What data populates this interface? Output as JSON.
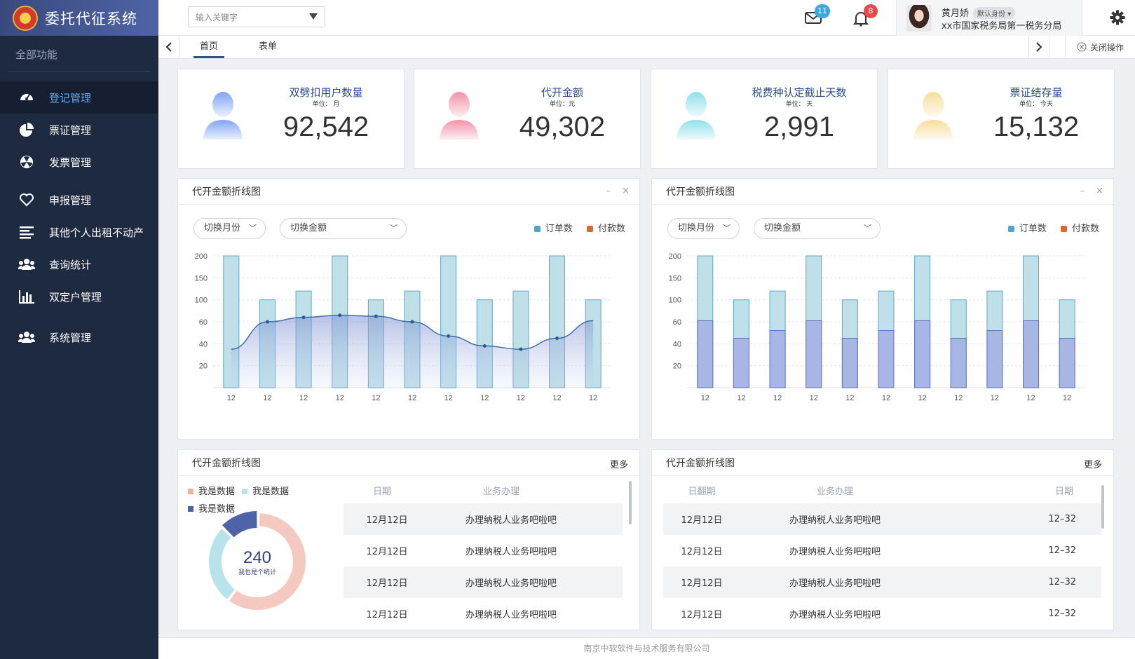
{
  "app": {
    "title": "委托代征系统",
    "all_functions": "全部功能"
  },
  "sidebar": {
    "items": [
      {
        "label": "登记管理",
        "icon": "dashboard-icon",
        "active": true
      },
      {
        "label": "票证管理",
        "icon": "pie-chart-icon"
      },
      {
        "label": "发票管理",
        "icon": "radiation-icon"
      },
      {
        "label": "申报管理",
        "icon": "heart-icon"
      },
      {
        "label": "其他个人出租不动产",
        "icon": "list-icon"
      },
      {
        "label": "查询统计",
        "icon": "users-icon"
      },
      {
        "label": "双定户管理",
        "icon": "bar-chart-icon"
      },
      {
        "label": "系统管理",
        "icon": "group-icon"
      }
    ]
  },
  "header": {
    "search_placeholder": "输入关键字",
    "mail_badge": "11",
    "bell_badge": "8",
    "user_name": "黄月娇",
    "user_role": "默认身份 ▾",
    "user_org": "xx市国家税务局第一税务分局"
  },
  "tabs": {
    "items": [
      "首页",
      "表单"
    ],
    "close_label": "关闭操作"
  },
  "stats": [
    {
      "title": "双劈扣用户数量",
      "unit": "单位：  月",
      "value": "92,542",
      "color": "#7fa6f2"
    },
    {
      "title": "代开金额",
      "unit": "单位：元",
      "value": "49,302",
      "color": "#f391a8"
    },
    {
      "title": "税费种认定截止天数",
      "unit": "单位：  天",
      "value": "2,991",
      "color": "#8fe0ea"
    },
    {
      "title": "票证结存量",
      "unit": "单位：  今天",
      "value": "15,132",
      "color": "#f7dd9a"
    }
  ],
  "panels": {
    "chart1": {
      "title": "代开金额折线图",
      "select1": "切换月份",
      "select2": "切换金额",
      "min_icon": "–",
      "close_icon": "×"
    },
    "chart2": {
      "title": "代开金额折线图",
      "select1": "切换月份",
      "select2": "切换金额",
      "min_icon": "–",
      "close_icon": "×"
    },
    "table1": {
      "title": "代开金额折线图",
      "more": "更多",
      "col1": "日期",
      "col2": "业务办理"
    },
    "table2": {
      "title": "代开金额折线图",
      "more": "更多",
      "col1": "日翻期",
      "col2": "业务办理",
      "col3": "日期"
    }
  },
  "chart_data": [
    {
      "type": "bar",
      "title": "代开金额折线图",
      "y_ticks": [
        "20",
        "40",
        "60",
        "100",
        "150",
        "200"
      ],
      "categories": [
        "12",
        "12",
        "12",
        "12",
        "12",
        "12",
        "12",
        "12",
        "12",
        "12",
        "12"
      ],
      "series": [
        {
          "name": "订单数",
          "color": "#4ba7c6",
          "values": [
            200,
            100,
            120,
            200,
            100,
            120,
            200,
            100,
            120,
            200,
            100
          ]
        },
        {
          "name": "付款数",
          "color": "#e8632b",
          "values": [
            35,
            60,
            68,
            72,
            70,
            60,
            47,
            38,
            35,
            45,
            62
          ]
        }
      ]
    },
    {
      "type": "bar",
      "title": "代开金额折线图",
      "y_ticks": [
        "20",
        "40",
        "60",
        "100",
        "150",
        "200"
      ],
      "categories": [
        "12",
        "12",
        "12",
        "12",
        "12",
        "12",
        "12",
        "12",
        "12",
        "12",
        "12"
      ],
      "series": [
        {
          "name": "订单数",
          "color": "#4ba7c6",
          "values": [
            200,
            100,
            120,
            200,
            100,
            120,
            200,
            100,
            120,
            200,
            100
          ]
        },
        {
          "name": "付款数",
          "color": "#e8632b",
          "values": [
            62,
            45,
            52,
            62,
            45,
            52,
            62,
            45,
            52,
            62,
            45
          ]
        }
      ]
    },
    {
      "type": "pie",
      "center_value": "240",
      "center_label": "我也是个统计",
      "legend": [
        "我是数据",
        "我是数据",
        "我是数据"
      ],
      "colors": [
        "#f4c9c0",
        "#b9e3ea",
        "#4e63a8"
      ],
      "values": [
        60,
        27,
        13
      ]
    }
  ],
  "table1_rows": [
    {
      "date": "12月12日",
      "task": "办理纳税人业务吧啦吧"
    },
    {
      "date": "12月12日",
      "task": "办理纳税人业务吧啦吧"
    },
    {
      "date": "12月12日",
      "task": "办理纳税人业务吧啦吧"
    },
    {
      "date": "12月12日",
      "task": "办理纳税人业务吧啦吧"
    }
  ],
  "table2_rows": [
    {
      "date": "12月12日",
      "task": "办理纳税人业务吧啦吧",
      "code": "12–32"
    },
    {
      "date": "12月12日",
      "task": "办理纳税人业务吧啦吧",
      "code": "12–32"
    },
    {
      "date": "12月12日",
      "task": "办理纳税人业务吧啦吧",
      "code": "12–32"
    },
    {
      "date": "12月12日",
      "task": "办理纳税人业务吧啦吧",
      "code": "12–32"
    }
  ],
  "footer": "南京中软软件与技术服务有限公司"
}
